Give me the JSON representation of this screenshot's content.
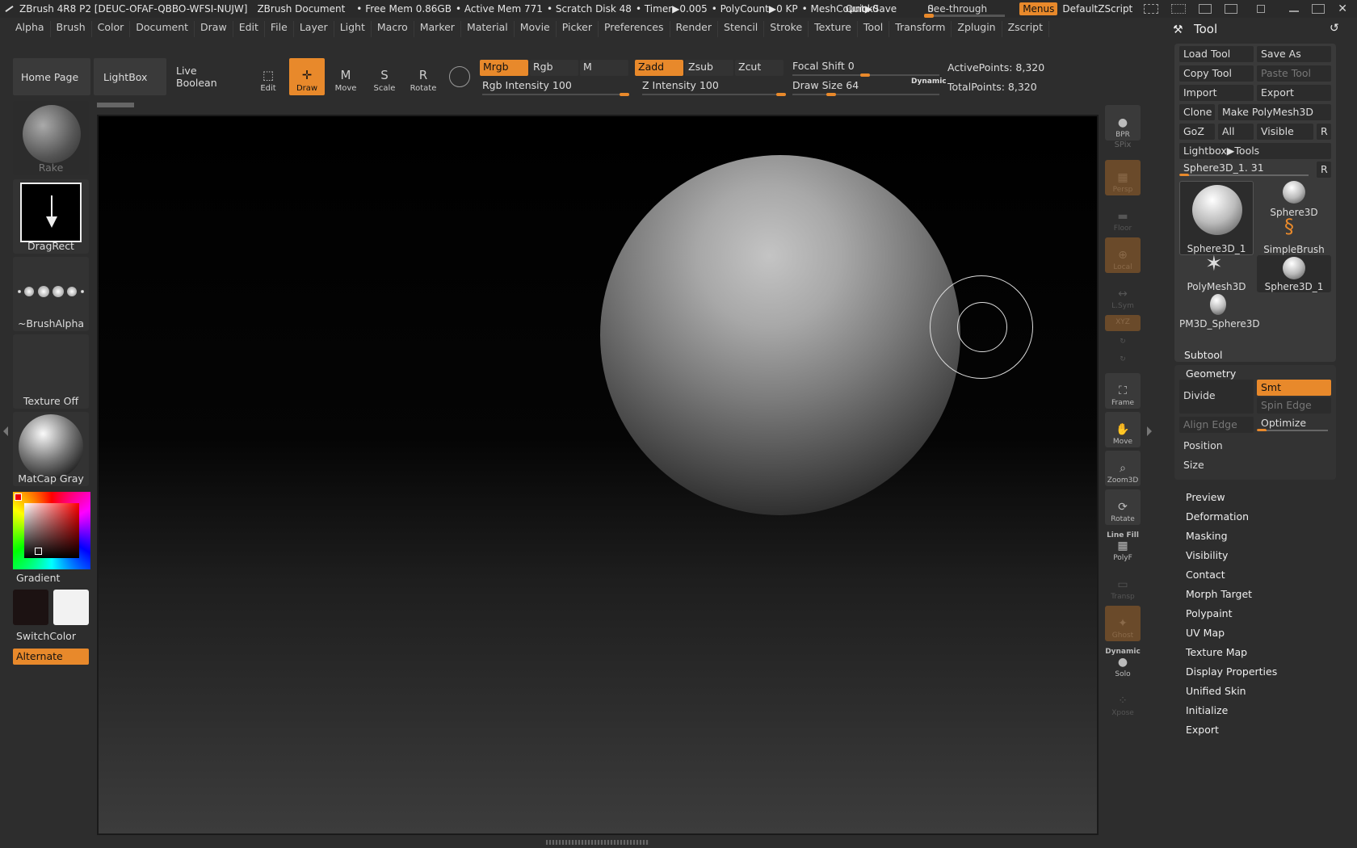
{
  "titlebar": {
    "app": "ZBrush 4R8 P2 [DEUC-OFAF-QBBO-WFSI-NUJW]",
    "doc": "ZBrush Document",
    "free_mem": "• Free Mem 0.86GB",
    "active_mem": "• Active Mem 771",
    "scratch": "• Scratch Disk 48",
    "timer": "• Timer▶0.005",
    "polycount": "• PolyCount▶0 KP",
    "meshcount": "• MeshCount▶0",
    "quicksave": "QuickSave",
    "see_through_label": "See-through",
    "see_through_value": "0",
    "menus": "Menus",
    "default_zscript": "DefaultZScript"
  },
  "menubar": [
    "Alpha",
    "Brush",
    "Color",
    "Document",
    "Draw",
    "Edit",
    "File",
    "Layer",
    "Light",
    "Macro",
    "Marker",
    "Material",
    "Movie",
    "Picker",
    "Preferences",
    "Render",
    "Stencil",
    "Stroke",
    "Texture",
    "Tool",
    "Transform",
    "Zplugin",
    "Zscript"
  ],
  "topbar": {
    "home_page": "Home Page",
    "lightbox": "LightBox",
    "live_boolean": "Live Boolean",
    "tools": [
      {
        "label": "Edit",
        "key": ""
      },
      {
        "label": "Draw",
        "key": ""
      },
      {
        "label": "Move",
        "key": "M"
      },
      {
        "label": "Scale",
        "key": "S"
      },
      {
        "label": "Rotate",
        "key": "R"
      }
    ],
    "modes": {
      "mrgb": "Mrgb",
      "rgb": "Rgb",
      "m": "M",
      "zadd": "Zadd",
      "zsub": "Zsub",
      "zcut": "Zcut"
    },
    "rgb_intensity": {
      "label": "Rgb Intensity",
      "value": "100"
    },
    "z_intensity": {
      "label": "Z Intensity",
      "value": "100"
    },
    "focal_shift": {
      "label": "Focal Shift",
      "value": "0"
    },
    "draw_size": {
      "label": "Draw Size",
      "value": "64"
    },
    "dynamic": "Dynamic",
    "active_points": "ActivePoints: 8,320",
    "total_points": "TotalPoints: 8,320"
  },
  "leftcol": {
    "brush": "Rake",
    "stroke": "DragRect",
    "alpha": "~BrushAlpha",
    "texture": "Texture Off",
    "material": "MatCap Gray",
    "gradient": "Gradient",
    "switch_color": "SwitchColor",
    "alternate": "Alternate",
    "swatch_main": "#1c1212",
    "swatch_secondary": "#f2f2f2"
  },
  "shelf": {
    "bpr": "BPR",
    "spix": "SPix",
    "persp": "Persp",
    "floor": "Floor",
    "local": "Local",
    "lsym": "L.Sym",
    "xyz": "XYZ",
    "frame": "Frame",
    "move": "Move",
    "zoom3d": "Zoom3D",
    "rotate": "Rotate",
    "linefill": "Line Fill",
    "polyf": "PolyF",
    "transp": "Transp",
    "ghost": "Ghost",
    "dynamic": "Dynamic",
    "solo": "Solo",
    "xpose": "Xpose"
  },
  "tool": {
    "title": "Tool",
    "load_tool": "Load Tool",
    "save_as": "Save As",
    "copy_tool": "Copy Tool",
    "paste_tool": "Paste Tool",
    "import": "Import",
    "export": "Export",
    "clone": "Clone",
    "make_polymesh": "Make PolyMesh3D",
    "goz": "GoZ",
    "all": "All",
    "visible": "Visible",
    "r": "R",
    "lightbox_tools": "Lightbox▶Tools",
    "current_tool": "Sphere3D_1. 31",
    "thumbs": {
      "sphere3d_1_big": "Sphere3D_1",
      "sphere3d": "Sphere3D",
      "simplebrush": "SimpleBrush",
      "polymesh3d": "PolyMesh3D",
      "sphere3d_1": "Sphere3D_1",
      "pm3d_sphere3d": "PM3D_Sphere3D"
    },
    "subtool": "Subtool",
    "geometry": "Geometry",
    "divide": "Divide",
    "smt": "Smt",
    "spin_edge": "Spin Edge",
    "align_edge": "Align Edge",
    "optimize": "Optimize",
    "position": "Position",
    "size": "Size",
    "menu": [
      "Preview",
      "Deformation",
      "Masking",
      "Visibility",
      "Contact",
      "Morph Target",
      "Polypaint",
      "UV Map",
      "Texture Map",
      "Display Properties",
      "Unified Skin",
      "Initialize",
      "Export"
    ]
  }
}
